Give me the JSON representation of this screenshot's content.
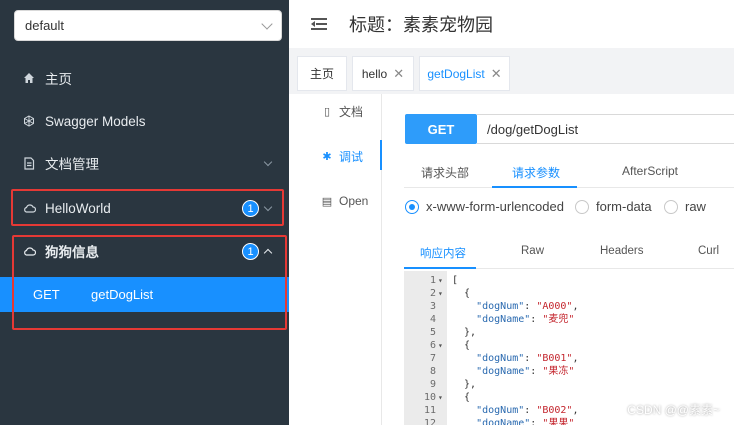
{
  "sidebar": {
    "group_select": "default",
    "items": [
      {
        "label": "主页",
        "icon": "home-icon"
      },
      {
        "label": "Swagger Models",
        "icon": "cube-icon"
      },
      {
        "label": "文档管理",
        "icon": "document-icon"
      },
      {
        "label": "HelloWorld",
        "icon": "cloud-icon",
        "badge": "1"
      },
      {
        "label": "狗狗信息",
        "icon": "cloud-icon",
        "badge": "1"
      }
    ],
    "endpoint": {
      "method": "GET",
      "name": "getDogList"
    }
  },
  "header": {
    "title": "标题：素素宠物园"
  },
  "tabs": [
    {
      "label": "主页"
    },
    {
      "label": "hello"
    },
    {
      "label": "getDogList"
    }
  ],
  "vtabs": [
    {
      "label": "文档"
    },
    {
      "label": "调试"
    },
    {
      "label": "Open"
    }
  ],
  "request": {
    "method": "GET",
    "url": "/dog/getDogList"
  },
  "subtabs": [
    "请求头部",
    "请求参数",
    "AfterScript"
  ],
  "radios": [
    "x-www-form-urlencoded",
    "form-data",
    "raw"
  ],
  "response_tabs": [
    "响应内容",
    "Raw",
    "Headers",
    "Curl"
  ],
  "code_lines": [
    {
      "n": "1",
      "fold": true,
      "text": "["
    },
    {
      "n": "2",
      "fold": true,
      "text": "  {"
    },
    {
      "n": "3",
      "key": "dogNum",
      "val": "A000",
      "comma": ","
    },
    {
      "n": "4",
      "key": "dogName",
      "val": "麦兜",
      "comma": ""
    },
    {
      "n": "5",
      "text": "  },"
    },
    {
      "n": "6",
      "fold": true,
      "text": "  {"
    },
    {
      "n": "7",
      "key": "dogNum",
      "val": "B001",
      "comma": ","
    },
    {
      "n": "8",
      "key": "dogName",
      "val": "果冻",
      "comma": ""
    },
    {
      "n": "9",
      "text": "  },"
    },
    {
      "n": "10",
      "fold": true,
      "text": "  {"
    },
    {
      "n": "11",
      "key": "dogNum",
      "val": "B002",
      "comma": ","
    },
    {
      "n": "12",
      "key": "dogName",
      "val": "果果",
      "comma": ""
    }
  ],
  "watermark": "CSDN @@素素~",
  "colors": {
    "accent": "#1890ff",
    "sidebar_bg": "#2a3640",
    "highlight_box": "#e53935"
  }
}
